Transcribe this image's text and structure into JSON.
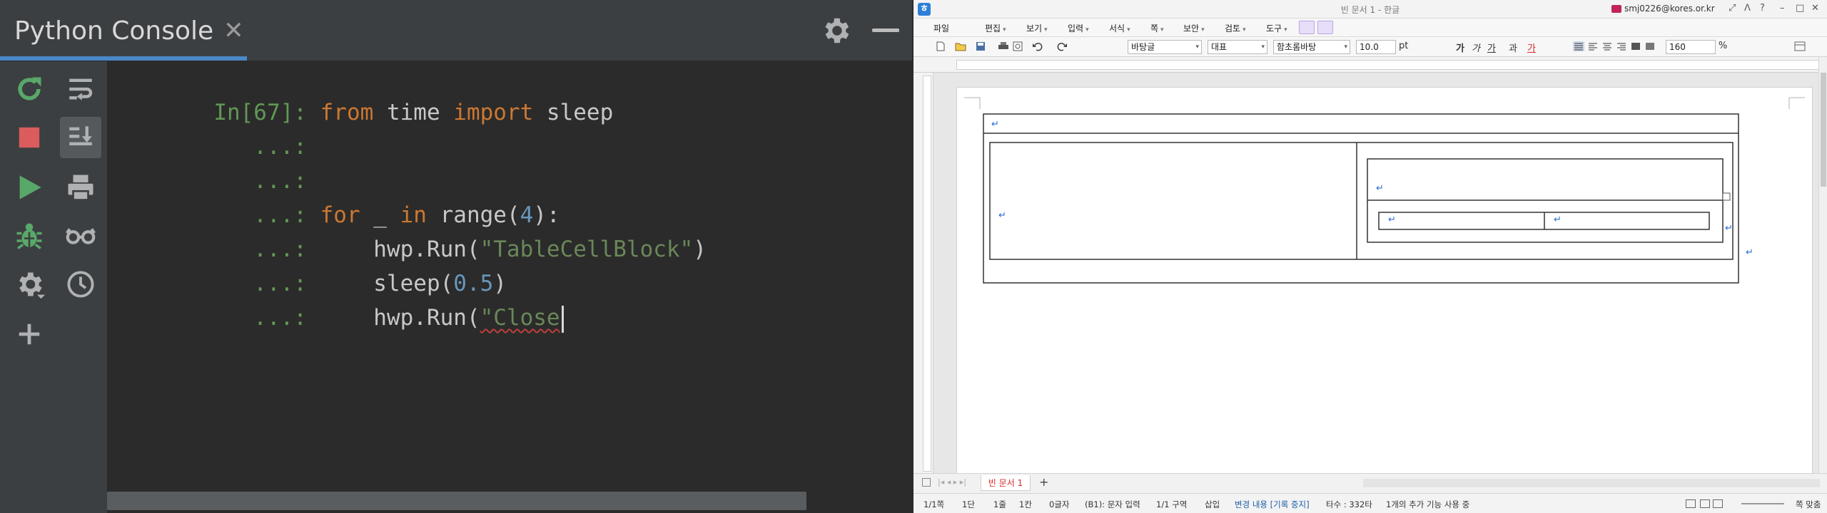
{
  "console": {
    "tab_title": "Python Console",
    "tab_close": "✕",
    "lines": [
      {
        "prompt": "In[67]:",
        "parts": [
          {
            "t": "kw",
            "v": "from"
          },
          {
            "t": "id",
            "v": " time "
          },
          {
            "t": "kw",
            "v": "import"
          },
          {
            "t": "id",
            "v": " sleep"
          }
        ]
      },
      {
        "prompt": "   ...:",
        "parts": []
      },
      {
        "prompt": "   ...:",
        "parts": []
      },
      {
        "prompt": "   ...:",
        "parts": [
          {
            "t": "kw",
            "v": "for"
          },
          {
            "t": "id",
            "v": " _ "
          },
          {
            "t": "kw",
            "v": "in"
          },
          {
            "t": "id",
            "v": " range("
          },
          {
            "t": "num",
            "v": "4"
          },
          {
            "t": "id",
            "v": "):"
          }
        ]
      },
      {
        "prompt": "   ...:",
        "parts": [
          {
            "t": "id",
            "v": "    hwp.Run("
          },
          {
            "t": "str",
            "v": "\"TableCellBlock\""
          },
          {
            "t": "id",
            "v": ")"
          }
        ]
      },
      {
        "prompt": "   ...:",
        "parts": [
          {
            "t": "id",
            "v": "    sleep("
          },
          {
            "t": "num",
            "v": "0.5"
          },
          {
            "t": "id",
            "v": ")"
          }
        ]
      },
      {
        "prompt": "   ...:",
        "parts": [
          {
            "t": "id",
            "v": "    hwp.Run("
          },
          {
            "t": "squig",
            "v": "\"Close"
          }
        ],
        "caret": true
      }
    ],
    "colors": {
      "keyword": "#cc7832",
      "identifier": "#c8c8c8",
      "string": "#6a8759",
      "number": "#6897bb",
      "prompt": "#629755",
      "accent": "#4a88c7"
    }
  },
  "hwp": {
    "title": "빈 문서 1 - 한글",
    "user": "smj0226@kores.or.kr",
    "window_controls": [
      "⤢",
      "ᐱ",
      "?",
      "–",
      "□",
      "✕"
    ],
    "menu": [
      "파일",
      "편집",
      "보기",
      "입력",
      "서식",
      "쪽",
      "보안",
      "검토",
      "도구"
    ],
    "toolbar": {
      "font_lang": "대표",
      "font_name": "함초롬바탕",
      "style_name": "바탕글",
      "font_size": "10.0",
      "size_unit": "pt",
      "zoom": "160",
      "zoom_unit": "%",
      "format_chars": [
        "가",
        "가",
        "가",
        "과",
        "가"
      ]
    },
    "doc_tab": "빈 문서 1",
    "status": {
      "page": "1/1쪽",
      "section_col": "1단",
      "line": "1줄",
      "column": "1칸",
      "chars": "0글자",
      "cell_mode": "(B1): 문자 입력",
      "section": "1/1 구역",
      "insert": "삽입",
      "track_changes": "변경 내용 [기록 중지]",
      "keystrokes": "타수 : 332타",
      "extra": "1개의 추가 기능 사용 중",
      "fit": "쪽 맞춤"
    },
    "paragraph_mark": "↵"
  }
}
